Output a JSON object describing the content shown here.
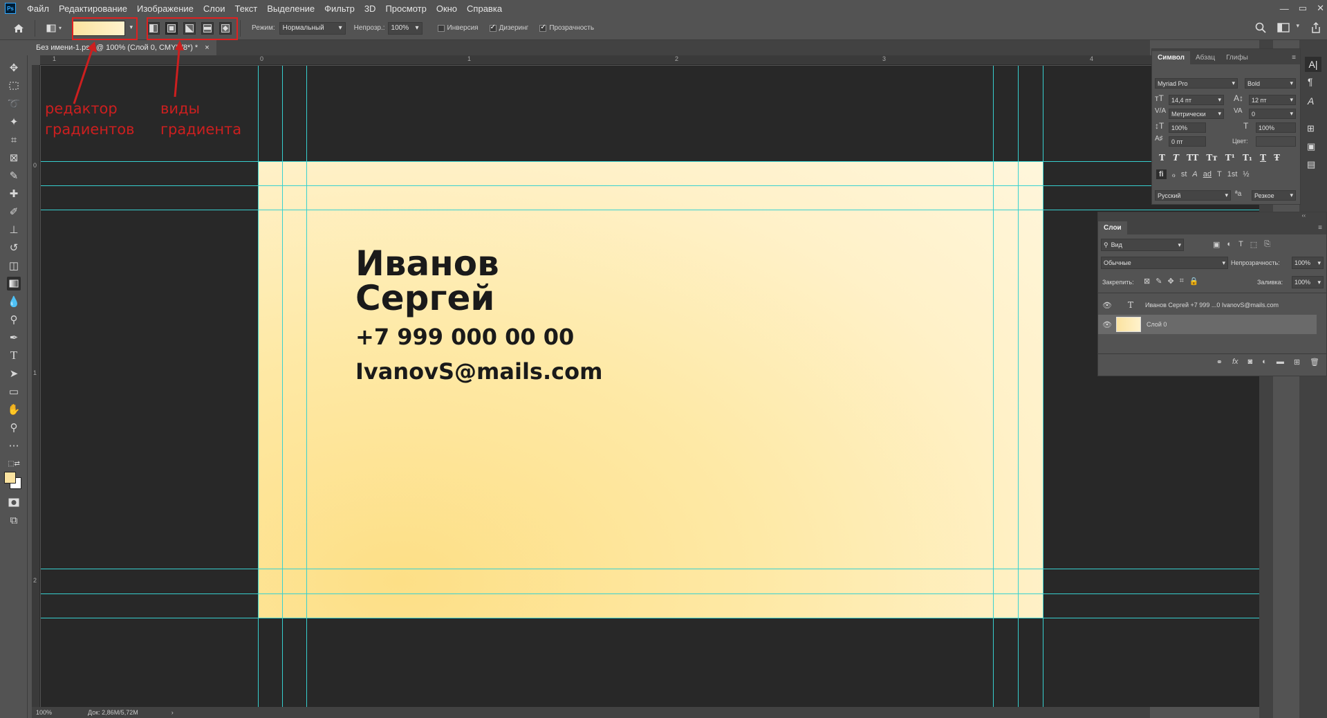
{
  "app": {
    "logo": "Ps",
    "win_controls": [
      "—",
      "▭",
      "✕"
    ]
  },
  "menu": [
    "Файл",
    "Редактирование",
    "Изображение",
    "Слои",
    "Текст",
    "Выделение",
    "Фильтр",
    "3D",
    "Просмотр",
    "Окно",
    "Справка"
  ],
  "options": {
    "mode_label": "Режим:",
    "mode_value": "Нормальный",
    "opacity_label": "Непрозр.:",
    "opacity_value": "100%",
    "inverse_label": "Инверсия",
    "dither_label": "Дизеринг",
    "transparency_label": "Прозрачность",
    "gradient_colors": [
      "#fbe3a0",
      "#fff2cc"
    ]
  },
  "document": {
    "tab_title": "Без имени-1.psd @ 100% (Слой 0, CMYK/8*) *",
    "tab_close": "×"
  },
  "rulers": {
    "top": [
      "1",
      "0",
      "1",
      "2",
      "3",
      "4"
    ],
    "left": [
      "0",
      "1",
      "2"
    ]
  },
  "card": {
    "surname": "Иванов",
    "name": "Сергей",
    "phone": "+7 999 000 00 00",
    "email": "IvanovS@mails.com",
    "text_color": "#1a1a1a",
    "bg_colors": [
      "#fddf86",
      "#fff6dc"
    ]
  },
  "annotations": {
    "gradient_editor": "редактор градиентов",
    "gradient_types": "виды градиента",
    "color": "#cc1f1f"
  },
  "status": {
    "zoom": "100%",
    "doc": "Док: 2,86M/5,72M"
  },
  "character_panel": {
    "tabs": [
      "Символ",
      "Абзац",
      "Глифы"
    ],
    "font_family": "Myriad Pro",
    "font_style": "Bold",
    "font_size": "14,4 пт",
    "leading": "12 пт",
    "kerning": "Метрически",
    "tracking": "0",
    "vertical_scale": "100%",
    "horizontal_scale": "100%",
    "baseline_shift": "0 пт",
    "color_label": "Цвет:",
    "language": "Русский",
    "antialias": "Резкое",
    "style_buttons": [
      "T",
      "T",
      "TT",
      "Tт",
      "T¹",
      "T₁",
      "T",
      "Ŧ"
    ],
    "opentype_buttons": [
      "fi",
      "ℴ",
      "st",
      "A",
      "ad",
      "T",
      "1st",
      "½"
    ]
  },
  "layers_panel": {
    "title": "Слои",
    "filter_label": "Вид",
    "blend_mode": "Обычные",
    "opacity_label": "Непрозрачность:",
    "opacity_value": "100%",
    "lock_label": "Закрепить:",
    "fill_label": "Заливка:",
    "fill_value": "100%",
    "layers": [
      {
        "type": "T",
        "name": "Иванов Сергей +7 999 ...0  IvanovS@mails.com"
      },
      {
        "type": "raster",
        "name": "Слой 0"
      }
    ]
  },
  "colors": {
    "accent_guide": "#37d0d0",
    "annotation": "#e02020",
    "foreground": "#fbe3a0",
    "background": "#ffffff"
  }
}
